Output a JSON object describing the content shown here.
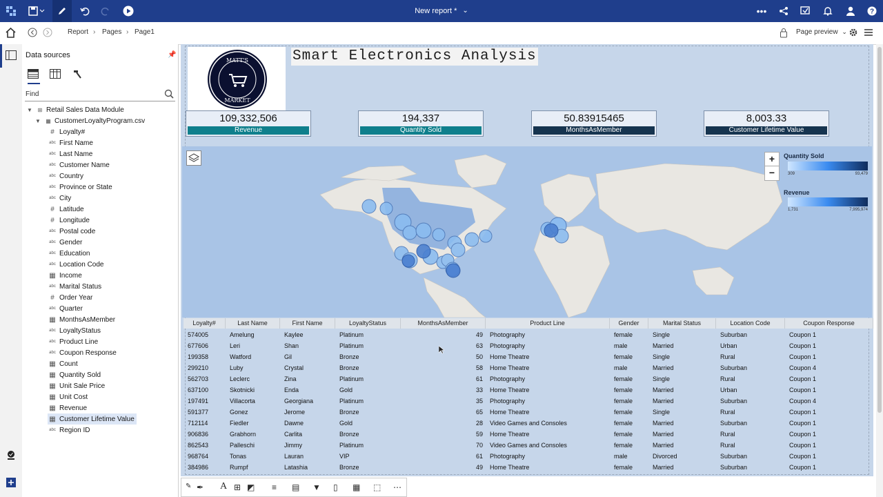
{
  "topbar": {
    "title": "New report *"
  },
  "breadcrumb": {
    "items": [
      "Report",
      "Pages",
      "Page1"
    ],
    "page_preview": "Page preview"
  },
  "data_panel": {
    "title": "Data sources",
    "find_placeholder": "Find",
    "module": "Retail Sales Data Module",
    "file": "CustomerLoyaltyProgram.csv",
    "fields": [
      {
        "label": "Loyalty#",
        "type": "#"
      },
      {
        "label": "First Name",
        "type": "abc"
      },
      {
        "label": "Last Name",
        "type": "abc"
      },
      {
        "label": "Customer Name",
        "type": "abc"
      },
      {
        "label": "Country",
        "type": "abc"
      },
      {
        "label": "Province or State",
        "type": "abc"
      },
      {
        "label": "City",
        "type": "abc"
      },
      {
        "label": "Latitude",
        "type": "#"
      },
      {
        "label": "Longitude",
        "type": "#"
      },
      {
        "label": "Postal code",
        "type": "abc"
      },
      {
        "label": "Gender",
        "type": "abc"
      },
      {
        "label": "Education",
        "type": "abc"
      },
      {
        "label": "Location Code",
        "type": "abc"
      },
      {
        "label": "Income",
        "type": "measure"
      },
      {
        "label": "Marital Status",
        "type": "abc"
      },
      {
        "label": "Order Year",
        "type": "#"
      },
      {
        "label": "Quarter",
        "type": "abc"
      },
      {
        "label": "MonthsAsMember",
        "type": "measure"
      },
      {
        "label": "LoyaltyStatus",
        "type": "abc"
      },
      {
        "label": "Product Line",
        "type": "abc"
      },
      {
        "label": "Coupon Response",
        "type": "abc"
      },
      {
        "label": "Count",
        "type": "measure"
      },
      {
        "label": "Quantity Sold",
        "type": "measure"
      },
      {
        "label": "Unit Sale Price",
        "type": "measure"
      },
      {
        "label": "Unit Cost",
        "type": "measure"
      },
      {
        "label": "Revenue",
        "type": "measure"
      },
      {
        "label": "Customer Lifetime Value",
        "type": "measure"
      },
      {
        "label": "Region ID",
        "type": "abc"
      }
    ],
    "selected_field": "Customer Lifetime Value"
  },
  "report": {
    "title": "Smart Electronics Analysis",
    "logo": "MATT'S MARKET",
    "kpis": [
      {
        "value": "109,332,506",
        "label": "Revenue",
        "color": "#0f7f8c"
      },
      {
        "value": "194,337",
        "label": "Quantity Sold",
        "color": "#0f7f8c"
      },
      {
        "value": "50.83915465",
        "label": "MonthsAsMember",
        "color": "#16344f"
      },
      {
        "value": "8,003.33",
        "label": "Customer Lifetime Value",
        "color": "#16344f"
      }
    ],
    "map_legend": {
      "quantity": {
        "title": "Quantity Sold",
        "min": "309",
        "max": "93,479"
      },
      "revenue": {
        "title": "Revenue",
        "min": "1,731",
        "max": "7,995,974"
      }
    },
    "table": {
      "columns": [
        "Loyalty#",
        "Last Name",
        "First Name",
        "LoyaltyStatus",
        "MonthsAsMember",
        "Product Line",
        "Gender",
        "Marital Status",
        "Location Code",
        "Coupon Response"
      ],
      "rows": [
        [
          "574005",
          "Amelung",
          "Kaylee",
          "Platinum",
          "49",
          "Photography",
          "female",
          "Single",
          "Suburban",
          "Coupon 1"
        ],
        [
          "677606",
          "Leri",
          "Shan",
          "Platinum",
          "63",
          "Photography",
          "male",
          "Married",
          "Urban",
          "Coupon 1"
        ],
        [
          "199358",
          "Watford",
          "Gil",
          "Bronze",
          "50",
          "Home Theatre",
          "female",
          "Single",
          "Rural",
          "Coupon 1"
        ],
        [
          "299210",
          "Luby",
          "Crystal",
          "Bronze",
          "58",
          "Home Theatre",
          "male",
          "Married",
          "Suburban",
          "Coupon 4"
        ],
        [
          "562703",
          "Leclerc",
          "Zina",
          "Platinum",
          "61",
          "Photography",
          "female",
          "Single",
          "Rural",
          "Coupon 1"
        ],
        [
          "637100",
          "Skotnicki",
          "Enda",
          "Gold",
          "33",
          "Home Theatre",
          "female",
          "Married",
          "Urban",
          "Coupon 1"
        ],
        [
          "197491",
          "Villacorta",
          "Georgiana",
          "Platinum",
          "35",
          "Photography",
          "female",
          "Married",
          "Suburban",
          "Coupon 4"
        ],
        [
          "591377",
          "Gonez",
          "Jerome",
          "Bronze",
          "65",
          "Home Theatre",
          "female",
          "Single",
          "Rural",
          "Coupon 1"
        ],
        [
          "712114",
          "Fiedler",
          "Dawne",
          "Gold",
          "28",
          "Video Games and Consoles",
          "female",
          "Married",
          "Suburban",
          "Coupon 1"
        ],
        [
          "906836",
          "Grabhorn",
          "Carlita",
          "Bronze",
          "59",
          "Home Theatre",
          "female",
          "Married",
          "Rural",
          "Coupon 1"
        ],
        [
          "862543",
          "Palleschi",
          "Jimmy",
          "Platinum",
          "70",
          "Video Games and Consoles",
          "female",
          "Married",
          "Rural",
          "Coupon 1"
        ],
        [
          "968764",
          "Tonas",
          "Lauran",
          "VIP",
          "61",
          "Photography",
          "male",
          "Divorced",
          "Suburban",
          "Coupon 1"
        ],
        [
          "384986",
          "Rumpf",
          "Latashia",
          "Bronze",
          "49",
          "Home Theatre",
          "female",
          "Married",
          "Suburban",
          "Coupon 1"
        ]
      ]
    }
  }
}
